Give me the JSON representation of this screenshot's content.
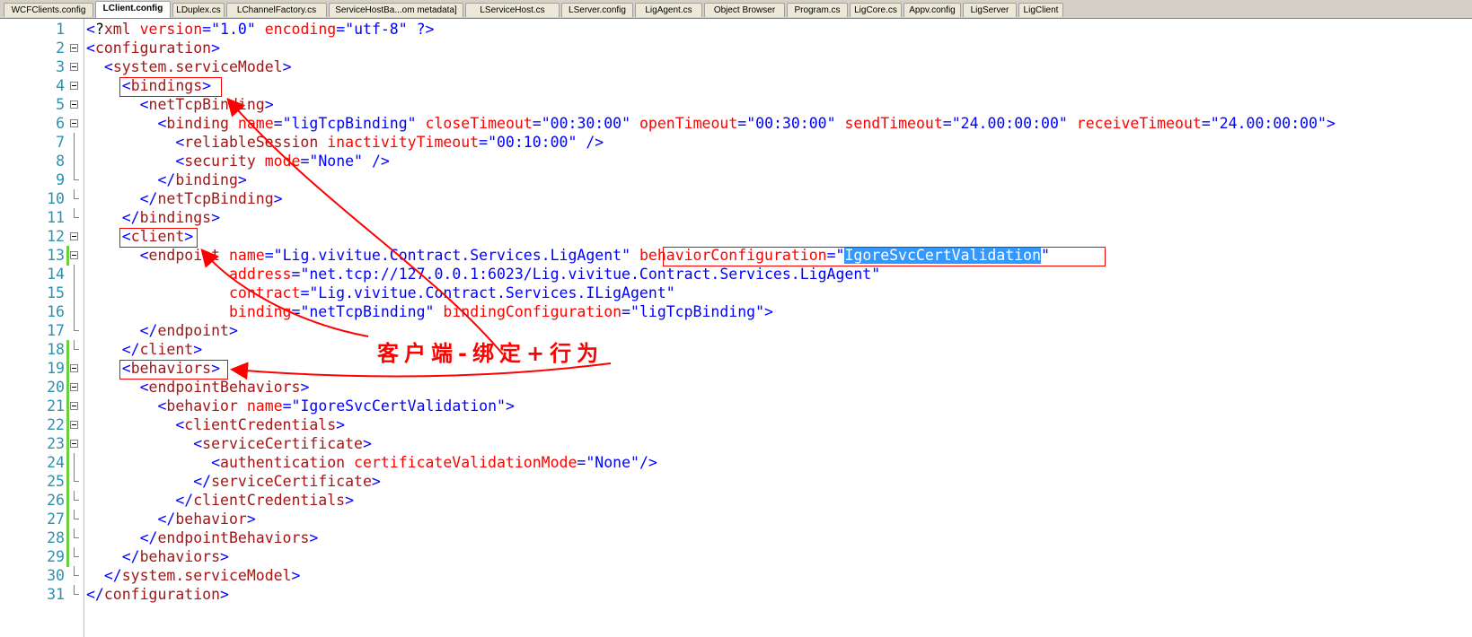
{
  "tabs": [
    {
      "label": "WCFClients.config",
      "active": false
    },
    {
      "label": "LClient.config",
      "active": true
    },
    {
      "label": "LDuplex.cs",
      "active": false
    },
    {
      "label": "LChannelFactory.cs",
      "active": false
    },
    {
      "label": "ServiceHostBa...om metadata]",
      "active": false
    },
    {
      "label": "LServiceHost.cs",
      "active": false
    },
    {
      "label": "LServer.config",
      "active": false
    },
    {
      "label": "LigAgent.cs",
      "active": false
    },
    {
      "label": "Object Browser",
      "active": false
    },
    {
      "label": "Program.cs",
      "active": false
    },
    {
      "label": "LigCore.cs",
      "active": false
    },
    {
      "label": "Appv.config",
      "active": false
    },
    {
      "label": "LigServer",
      "active": false
    },
    {
      "label": "LigClient",
      "active": false
    }
  ],
  "lines": [
    {
      "n": "1",
      "text": "<?xml version=\"1.0\" encoding=\"utf-8\" ?>"
    },
    {
      "n": "2",
      "text": "<configuration>"
    },
    {
      "n": "3",
      "text": "  <system.serviceModel>"
    },
    {
      "n": "4",
      "text": "    <bindings>"
    },
    {
      "n": "5",
      "text": "      <netTcpBinding>"
    },
    {
      "n": "6",
      "text": "        <binding name=\"ligTcpBinding\" closeTimeout=\"00:30:00\" openTimeout=\"00:30:00\" sendTimeout=\"24.00:00:00\" receiveTimeout=\"24.00:00:00\">"
    },
    {
      "n": "7",
      "text": "          <reliableSession inactivityTimeout=\"00:10:00\" />"
    },
    {
      "n": "8",
      "text": "          <security mode=\"None\" />"
    },
    {
      "n": "9",
      "text": "        </binding>"
    },
    {
      "n": "10",
      "text": "      </netTcpBinding>"
    },
    {
      "n": "11",
      "text": "    </bindings>"
    },
    {
      "n": "12",
      "text": "    <client>"
    },
    {
      "n": "13",
      "text": "      <endpoint name=\"Lig.vivitue.Contract.Services.LigAgent\" behaviorConfiguration=\"IgoreSvcCertValidation\""
    },
    {
      "n": "14",
      "text": "                address=\"net.tcp://127.0.0.1:6023/Lig.vivitue.Contract.Services.LigAgent\""
    },
    {
      "n": "15",
      "text": "                contract=\"Lig.vivitue.Contract.Services.ILigAgent\""
    },
    {
      "n": "16",
      "text": "                binding=\"netTcpBinding\" bindingConfiguration=\"ligTcpBinding\">"
    },
    {
      "n": "17",
      "text": "      </endpoint>"
    },
    {
      "n": "18",
      "text": "    </client>"
    },
    {
      "n": "19",
      "text": "    <behaviors>"
    },
    {
      "n": "20",
      "text": "      <endpointBehaviors>"
    },
    {
      "n": "21",
      "text": "        <behavior name=\"IgoreSvcCertValidation\">"
    },
    {
      "n": "22",
      "text": "          <clientCredentials>"
    },
    {
      "n": "23",
      "text": "            <serviceCertificate>"
    },
    {
      "n": "24",
      "text": "              <authentication certificateValidationMode=\"None\"/>"
    },
    {
      "n": "25",
      "text": "            </serviceCertificate>"
    },
    {
      "n": "26",
      "text": "          </clientCredentials>"
    },
    {
      "n": "27",
      "text": "        </behavior>"
    },
    {
      "n": "28",
      "text": "      </endpointBehaviors>"
    },
    {
      "n": "29",
      "text": "    </behaviors>"
    },
    {
      "n": "30",
      "text": "  </system.serviceModel>"
    },
    {
      "n": "31",
      "text": "</configuration>"
    }
  ],
  "annotation": {
    "text": "客户端-绑定+行为"
  },
  "colors": {
    "line_number": "#2b91af",
    "tag": "#0000ff",
    "attribute": "#ff0000",
    "value": "#0000ff",
    "element": "#a31515",
    "annotation": "#ff0000",
    "selection": "#3399ff"
  }
}
